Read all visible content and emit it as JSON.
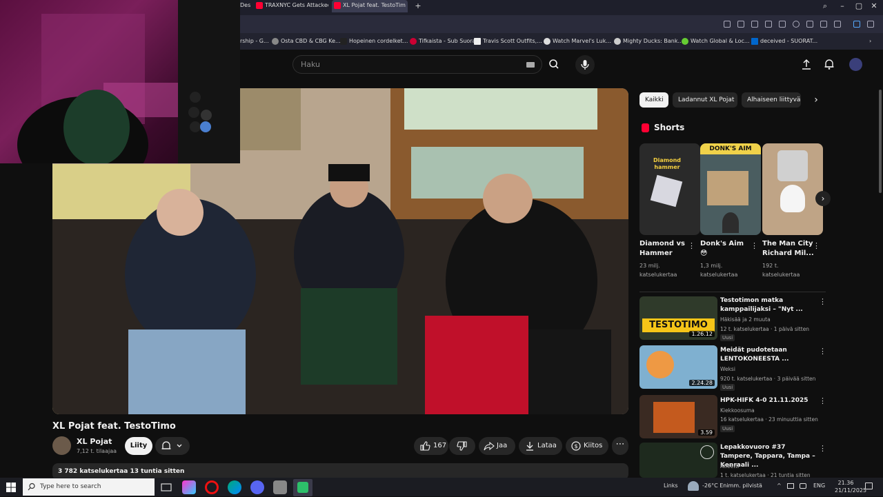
{
  "browser": {
    "tabs": [
      {
        "label": "Des"
      },
      {
        "label": "TRAXNYC Gets Attacked I"
      },
      {
        "label": "XL Pojat feat. TestoTim"
      }
    ],
    "bookmarks": [
      "rship - G...",
      "Osta CBD & CBG Ke...",
      "Hopeinen cordelket...",
      "Tifkaista - Sub Suora",
      "Travis Scott Outfits,...",
      "Watch Marvel's Luk...",
      "Mighty Ducks: Bank...",
      "Watch Global & Loc...",
      "deceived - SUORAT..."
    ]
  },
  "header": {
    "search_placeholder": "Haku"
  },
  "video": {
    "title": "XL Pojat feat. TestoTimo",
    "channel_name": "XL Pojat",
    "channel_subs": "7,12 t. tilaajaa",
    "join_label": "Liity",
    "like_count": "167",
    "share_label": "Jaa",
    "download_label": "Lataa",
    "thanks_label": "Kiitos",
    "description_meta": "3 782 katselukertaa  13 tuntia sitten"
  },
  "chips": [
    "Kaikki",
    "Ladannut XL Pojat",
    "Alhaiseen liittyvä"
  ],
  "shorts": {
    "heading": "Shorts",
    "items": [
      {
        "title_line1": "Diamond vs",
        "title_line2": "Hammer",
        "views_line1": "23 milj.",
        "views_line2": "katselukertaa",
        "thumb_text": "Diamond hammer"
      },
      {
        "title_line1": "Donk's Aim",
        "title_line2": "😳",
        "views_line1": "1,3 milj.",
        "views_line2": "katselukertaa",
        "thumb_text": "DONK'S AIM"
      },
      {
        "title_line1": "The Man City",
        "title_line2": "Richard Mil...",
        "views_line1": "192 t.",
        "views_line2": "katselukertaa",
        "thumb_text": ""
      }
    ]
  },
  "recommended": [
    {
      "title": "Testotimon matka kamppailijaksi – \"Nyt ...",
      "channel": "Häkisää ja 2 muuta",
      "meta": "12 t. katselukertaa · 1 päivä sitten",
      "badge": "Uusi",
      "duration": "1.26.12",
      "thumb_text": "TESTOTIMO"
    },
    {
      "title": "Meidät pudotetaan LENTOKONEESTA ...",
      "channel": "Weksi",
      "meta": "920 t. katselukertaa · 3 päivää sitten",
      "badge": "Uusi",
      "duration": "2.24.28",
      "thumb_text": ""
    },
    {
      "title": "HPK-HIFK 4-0 21.11.2025",
      "channel": "Kiekkoosuma",
      "meta": "16 katselukertaa · 23 minuuttia sitten",
      "badge": "Uusi",
      "duration": "3.59",
      "thumb_text": ""
    },
    {
      "title": "Lepakkovuoro #37 Tampere, Tappara, Tampa – Kenraali ...",
      "channel": "Atleetti",
      "meta": "1 t. katselukertaa · 21 tuntia sitten",
      "badge": "",
      "duration": "",
      "thumb_text": ""
    }
  ],
  "taskbar": {
    "search_placeholder": "Type here to search",
    "links_label": "Links",
    "weather": "-26°C  Enimm. pilvistä",
    "language": "ENG",
    "time": "21.36",
    "date": "21/11/2025"
  },
  "colors": {
    "accent": "#ff0033",
    "background": "#0f0f0f",
    "chip": "#272727"
  }
}
